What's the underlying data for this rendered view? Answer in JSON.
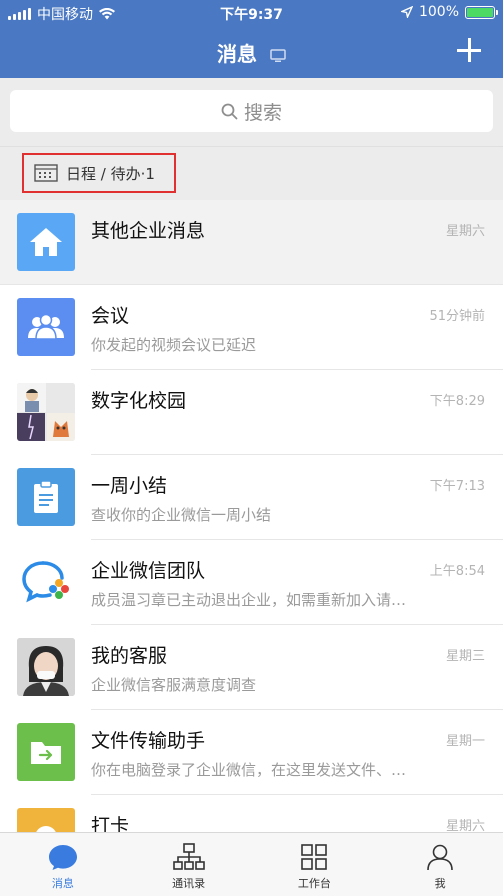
{
  "status_bar": {
    "carrier": "中国移动",
    "time": "下午9:37",
    "battery": "100%",
    "battery_level": 1.0
  },
  "nav": {
    "title": "消息"
  },
  "search": {
    "placeholder": "搜索"
  },
  "schedule": {
    "label": "日程 / 待办·1"
  },
  "messages": [
    {
      "title": "其他企业消息",
      "subtitle": "",
      "time": "星期六",
      "avatar": "home-icon",
      "color": "#5aa8f5"
    },
    {
      "title": "会议",
      "subtitle": "你发起的视频会议已延迟",
      "time": "51分钟前",
      "avatar": "people-icon",
      "color": "#5b8ef0"
    },
    {
      "title": "数字化校园",
      "subtitle": "",
      "time": "下午8:29",
      "avatar": "group-photo-icon",
      "color": "#dcdcdc"
    },
    {
      "title": "一周小结",
      "subtitle": "查收你的企业微信一周小结",
      "time": "下午7:13",
      "avatar": "clipboard-icon",
      "color": "#4b9be0"
    },
    {
      "title": "企业微信团队",
      "subtitle": "成员温习章已主动退出企业，如需重新加入请…",
      "time": "上午8:54",
      "avatar": "wecom-logo-icon",
      "color": "#ffffff"
    },
    {
      "title": "我的客服",
      "subtitle": "企业微信客服满意度调查",
      "time": "星期三",
      "avatar": "support-person-icon",
      "color": "#cfcfcf"
    },
    {
      "title": "文件传输助手",
      "subtitle": "你在电脑登录了企业微信，在这里发送文件、…",
      "time": "星期一",
      "avatar": "folder-icon",
      "color": "#6bbf4a"
    },
    {
      "title": "打卡",
      "subtitle": "",
      "time": "星期六",
      "avatar": "checkin-icon",
      "color": "#f0b43c"
    }
  ],
  "tabs": [
    {
      "label": "消息",
      "icon": "chat-bubble-icon",
      "active": true
    },
    {
      "label": "通讯录",
      "icon": "org-chart-icon",
      "active": false
    },
    {
      "label": "工作台",
      "icon": "grid-icon",
      "active": false
    },
    {
      "label": "我",
      "icon": "person-icon",
      "active": false
    }
  ],
  "colors": {
    "header": "#4a78c2",
    "accent": "#3a7be0",
    "highlight_border": "#e03030"
  }
}
